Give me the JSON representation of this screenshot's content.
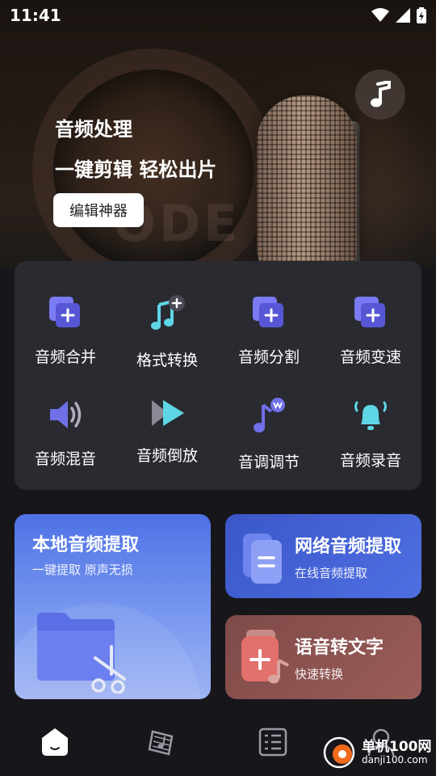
{
  "status_bar": {
    "time": "11:41"
  },
  "hero": {
    "title": "音频处理",
    "subtitle": "一键剪辑 轻松出片",
    "button_label": "编辑神器",
    "music_icon": "music-note-icon"
  },
  "tools": [
    {
      "label": "音频合并",
      "icon": "audio-merge-icon"
    },
    {
      "label": "格式转换",
      "icon": "format-convert-icon"
    },
    {
      "label": "音频分割",
      "icon": "audio-split-icon"
    },
    {
      "label": "音频变速",
      "icon": "audio-speed-icon"
    },
    {
      "label": "音频混音",
      "icon": "audio-mix-icon"
    },
    {
      "label": "音频倒放",
      "icon": "audio-reverse-icon"
    },
    {
      "label": "音调调节",
      "icon": "pitch-adjust-icon"
    },
    {
      "label": "音频录音",
      "icon": "audio-record-icon"
    }
  ],
  "cards": {
    "local": {
      "title": "本地音频提取",
      "subtitle": "一键提取 原声无损"
    },
    "network": {
      "title": "网络音频提取",
      "subtitle": "在线音频提取"
    },
    "speech": {
      "title": "语音转文字",
      "subtitle": "快速转换"
    }
  },
  "bottom_nav": [
    {
      "icon": "home-icon",
      "active": true
    },
    {
      "icon": "sheet-music-icon",
      "active": false
    },
    {
      "icon": "list-icon",
      "active": false
    },
    {
      "icon": "profile-icon",
      "active": false
    }
  ],
  "watermark": {
    "name": "单机100网",
    "url": "danji100.com"
  },
  "colors": {
    "background": "#17171b",
    "tool_card": "#2a2a31",
    "accent_blue": "#4f6fe2",
    "accent_red": "#9a5d58",
    "icon_purple": "#6f6fe8",
    "icon_cyan": "#5fd6e6"
  }
}
